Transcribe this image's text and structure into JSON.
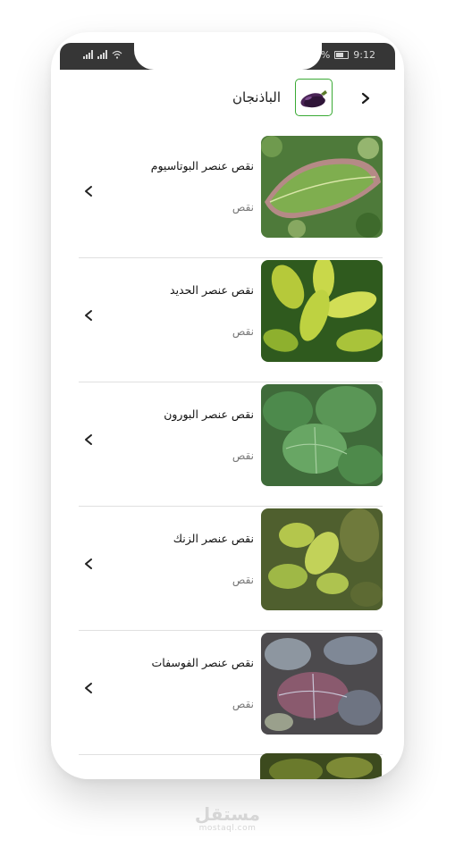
{
  "status_bar": {
    "battery_text": "%",
    "time": "9:12"
  },
  "header": {
    "title": "الباذنجان",
    "back_icon": "chevron-right-icon",
    "category_icon": "eggplant-icon",
    "accent_color": "#3aaa35"
  },
  "items": [
    {
      "title": "نقص عنصر البوتاسيوم",
      "subtitle": "نقص",
      "image": "leaf-potassium-deficiency"
    },
    {
      "title": "نقص عنصر الحديد",
      "subtitle": "نقص",
      "image": "leaf-iron-deficiency"
    },
    {
      "title": "نقص عنصر البورون",
      "subtitle": "نقص",
      "image": "leaf-boron-deficiency"
    },
    {
      "title": "نقص عنصر الزنك",
      "subtitle": "نقص",
      "image": "leaf-zinc-deficiency"
    },
    {
      "title": "نقص عنصر الفوسفات",
      "subtitle": "نقص",
      "image": "leaf-phosphate-deficiency"
    }
  ],
  "watermark": {
    "main": "مستقل",
    "sub": "mostaql.com"
  }
}
